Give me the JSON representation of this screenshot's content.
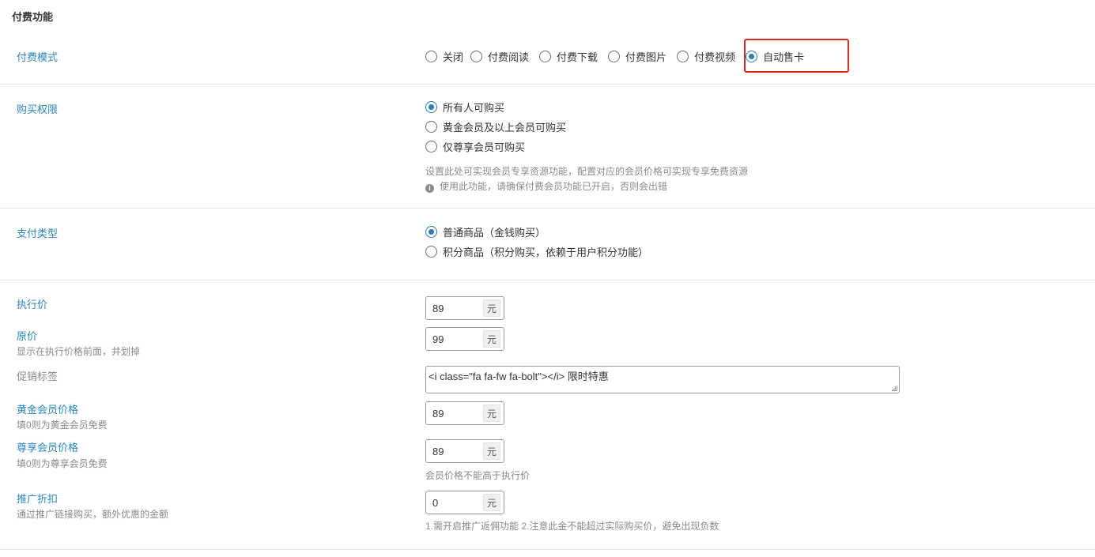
{
  "page": {
    "title": "付费功能"
  },
  "pay_mode": {
    "label": "付费模式",
    "options": [
      {
        "label": "关闭",
        "checked": false
      },
      {
        "label": "付费阅读",
        "checked": false
      },
      {
        "label": "付费下载",
        "checked": false
      },
      {
        "label": "付费图片",
        "checked": false
      },
      {
        "label": "付费视频",
        "checked": false
      },
      {
        "label": "自动售卡",
        "checked": true
      }
    ]
  },
  "purchase_permission": {
    "label": "购买权限",
    "options": [
      {
        "label": "所有人可购买",
        "checked": true
      },
      {
        "label": "黄金会员及以上会员可购买",
        "checked": false
      },
      {
        "label": "仅尊享会员可购买",
        "checked": false
      }
    ],
    "hint": "设置此处可实现会员专享资源功能，配置对应的会员价格可实现专享免费资源",
    "warning": "使用此功能，请确保付费会员功能已开启，否则会出错",
    "warning_icon": "info-icon"
  },
  "payment_type": {
    "label": "支付类型",
    "options": [
      {
        "label": "普通商品（金钱购买）",
        "checked": true
      },
      {
        "label": "积分商品（积分购买，依赖于用户积分功能）",
        "checked": false
      }
    ]
  },
  "pricing": {
    "exec_price": {
      "label": "执行价",
      "value": "89",
      "unit": "元"
    },
    "original_price": {
      "label": "原价",
      "desc": "显示在执行价格前面，并划掉",
      "value": "99",
      "unit": "元"
    },
    "promo_tag": {
      "label": "促销标签",
      "value": "<i class=\"fa fa-fw fa-bolt\"></i> 限时特惠"
    },
    "gold_price": {
      "label": "黄金会员价格",
      "desc": "填0则为黄金会员免费",
      "value": "89",
      "unit": "元"
    },
    "premium_price": {
      "label": "尊享会员价格",
      "desc": "填0则为尊享会员免费",
      "value": "89",
      "unit": "元",
      "hint": "会员价格不能高于执行价"
    },
    "promo_discount": {
      "label": "推广折扣",
      "desc": "通过推广链接购买，额外优惠的金额",
      "value": "0",
      "unit": "元",
      "hint": "1.需开启推广返佣功能 2.注意此金不能超过实际购买价，避免出现负数"
    }
  },
  "colors": {
    "label_blue": "#2a86c4",
    "radio_blue": "#2a7bc0",
    "highlight_red": "#e0261f"
  }
}
